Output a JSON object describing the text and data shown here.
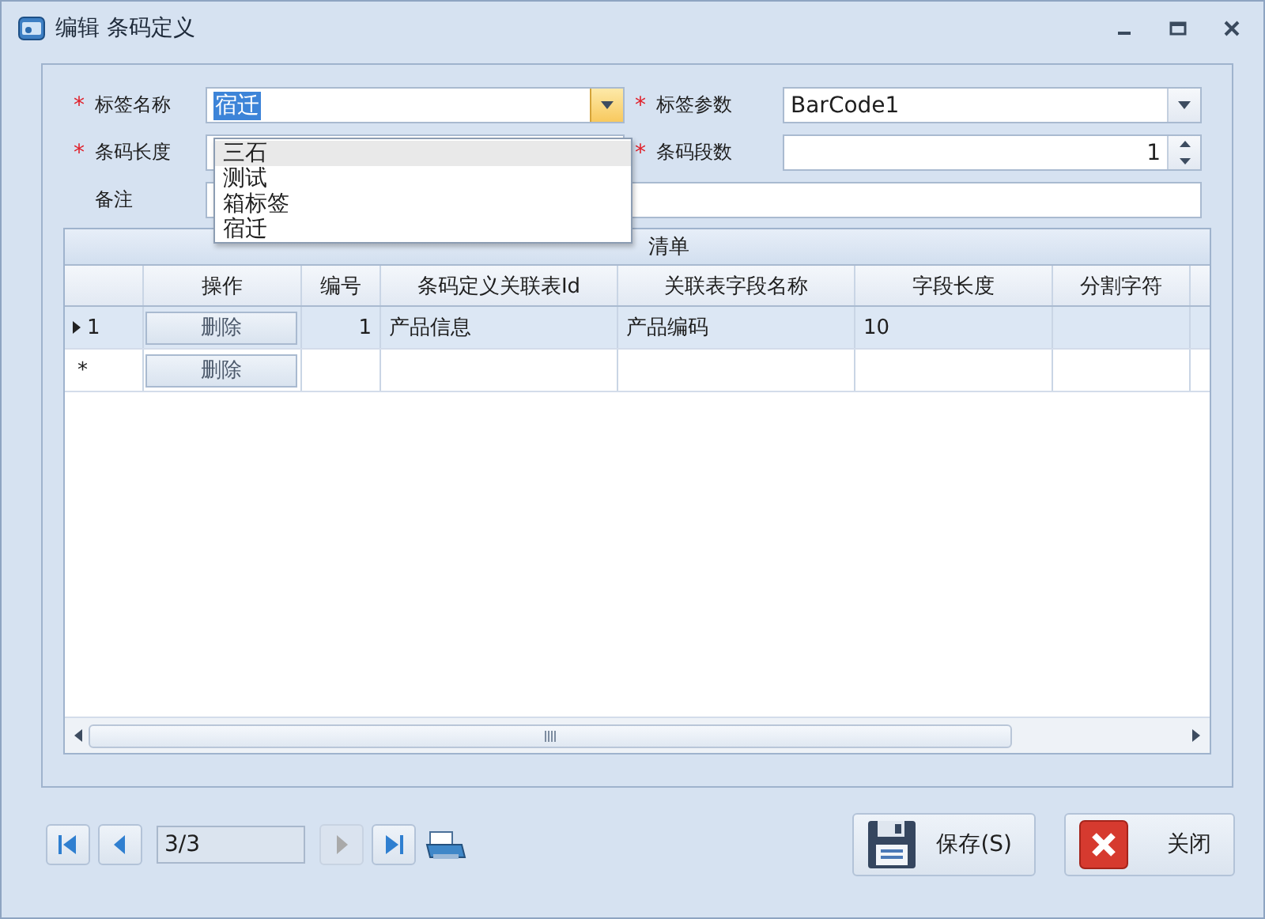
{
  "window": {
    "title": "编辑 条码定义"
  },
  "form": {
    "fields": [
      {
        "kind": "combo",
        "label": "标签名称",
        "required": true,
        "value": "宿迁",
        "value_selected": true,
        "open": true
      },
      {
        "kind": "combo",
        "label": "标签参数",
        "required": true,
        "value": "BarCode1",
        "value_selected": false,
        "open": false
      },
      {
        "kind": "text",
        "label": "条码长度",
        "required": true
      },
      {
        "kind": "spin",
        "label": "条码段数",
        "required": true,
        "value": "1"
      },
      {
        "kind": "memo",
        "label": "备注",
        "required": false
      }
    ],
    "dropdown": {
      "options": [
        {
          "label": "三石",
          "highlighted": true
        },
        {
          "label": "测试",
          "highlighted": false
        },
        {
          "label": "箱标签",
          "highlighted": false
        },
        {
          "label": "宿迁",
          "highlighted": false
        }
      ]
    }
  },
  "grid": {
    "title": "清单",
    "columns": [
      {
        "label": "操作"
      },
      {
        "label": "编号"
      },
      {
        "label": "条码定义关联表Id"
      },
      {
        "label": "关联表字段名称"
      },
      {
        "label": "字段长度"
      },
      {
        "label": "分割字符"
      }
    ],
    "rows": [
      {
        "kind": "data",
        "selected": true,
        "indicator": "1",
        "cells": [
          "删除",
          "1",
          "产品信息",
          "产品编码",
          "10"
        ]
      },
      {
        "kind": "new",
        "selected": false,
        "indicator": "*",
        "cells": [
          "删除"
        ]
      }
    ]
  },
  "pager": {
    "position": "3/3",
    "buttons": [
      {
        "kind": "first",
        "disabled": false
      },
      {
        "kind": "prev",
        "disabled": false
      },
      {
        "kind": "next",
        "disabled": true
      },
      {
        "kind": "last",
        "disabled": false
      }
    ]
  },
  "actions": [
    {
      "kind": "save",
      "label": "保存(S)"
    },
    {
      "kind": "close",
      "label": "关闭"
    }
  ]
}
